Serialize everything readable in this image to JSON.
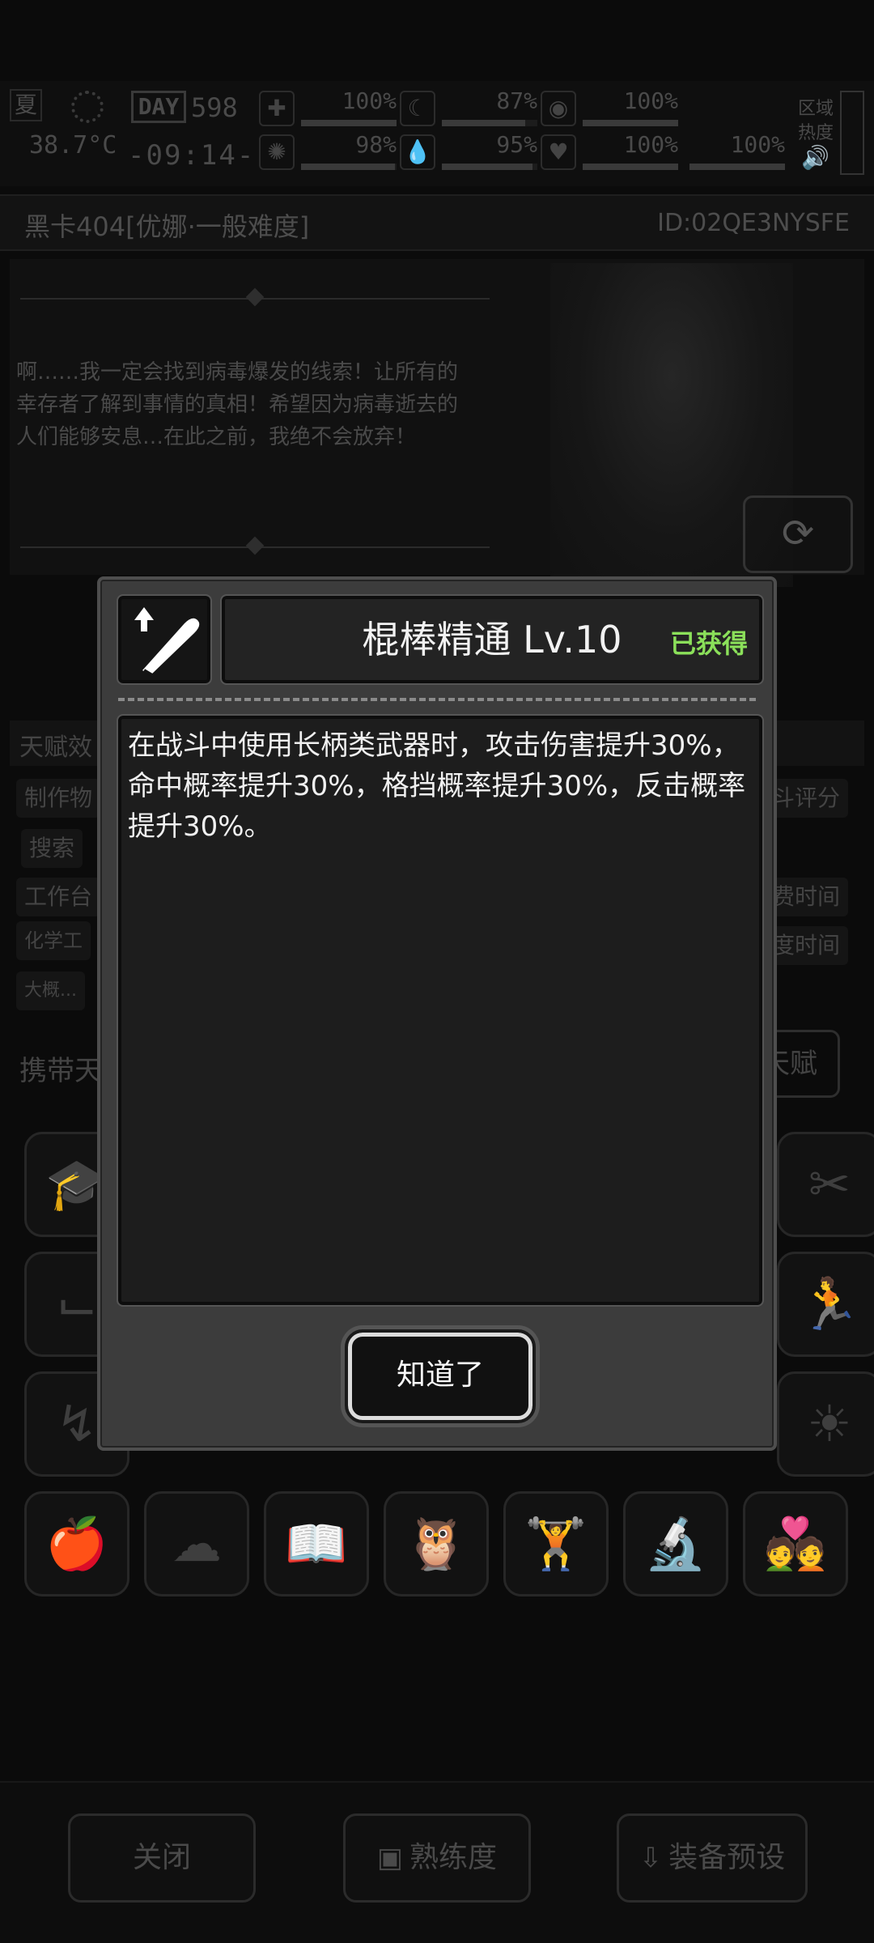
{
  "status": {
    "season": "夏",
    "temperature": "38.7°C",
    "day_label": "DAY",
    "day_number": "598",
    "clock": "-09:14-",
    "stats": [
      {
        "icon": "medkit-icon",
        "glyph": "✚",
        "value": "100%",
        "level": 1.0
      },
      {
        "icon": "stomach-icon",
        "glyph": "☾",
        "value": "87%",
        "level": 0.87
      },
      {
        "icon": "bladder-icon",
        "glyph": "◉",
        "value": "100%",
        "level": 1.0
      },
      {
        "icon": "brain-icon",
        "glyph": "✺",
        "value": "98%",
        "level": 0.98
      },
      {
        "icon": "water-drop-icon",
        "glyph": "💧",
        "value": "95%",
        "level": 0.95
      },
      {
        "icon": "heart-icon",
        "glyph": "♥",
        "value": "100%",
        "level": 1.0
      },
      {
        "icon": "",
        "glyph": "",
        "value": "100%",
        "level": 1.0
      }
    ],
    "region_heat_label": "区域\n热度"
  },
  "character": {
    "title": "黑卡404[优娜·一般难度]",
    "id": "ID:02QE3NYSFE",
    "story": "啊……我一定会找到病毒爆发的线索！让所有的幸存者了解到事情的真相！希望因为病毒逝去的人们能够安息…在此之前，我绝不会放弃！"
  },
  "talents": {
    "header": "天赋效",
    "chips": [
      "制作物",
      "搜索",
      "工作台",
      "化学工",
      "大概..."
    ],
    "right_chips": [
      "斗评分",
      "费时间",
      "度时间"
    ],
    "carry_label": "携带天",
    "carry_button": "天赋"
  },
  "bottom": {
    "close": "关闭",
    "proficiency": "熟练度",
    "preset": "装备预设"
  },
  "modal": {
    "skill_title": "棍棒精通 Lv.10",
    "status_badge": "已获得",
    "description": "在战斗中使用长柄类武器时，攻击伤害提升30%，命中概率提升30%，格挡概率提升30%，反击概率提升30%。",
    "confirm_label": "知道了",
    "badge_color": "#8be05a"
  }
}
